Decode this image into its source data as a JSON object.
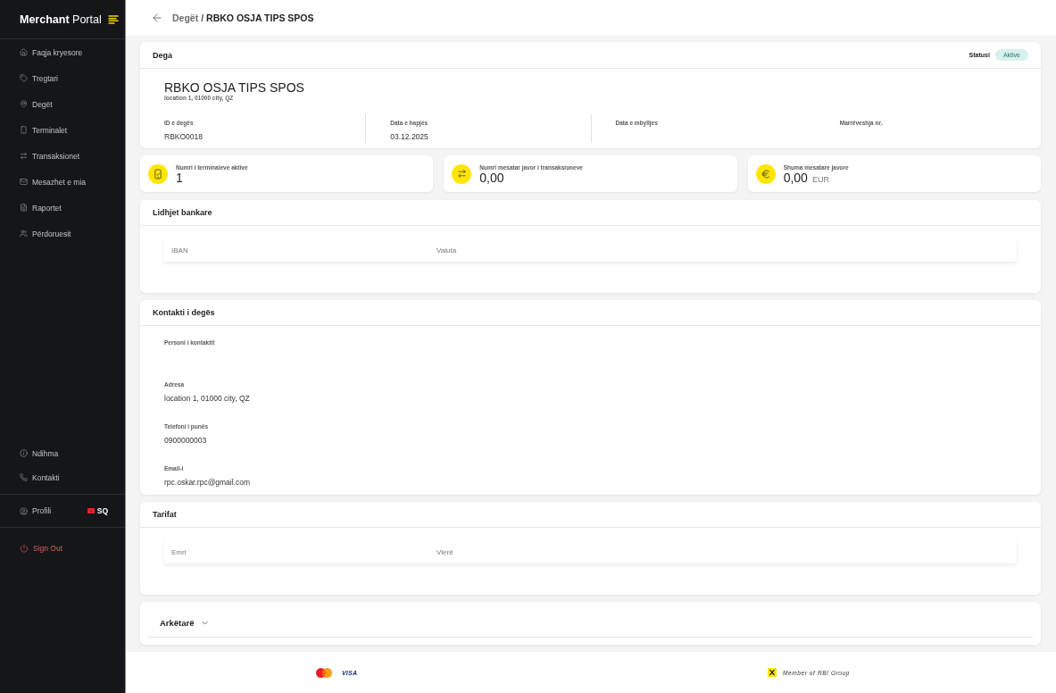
{
  "sidebar": {
    "brand": "**Merchant** Portal",
    "nav_items": [
      {
        "label": "Faqja kryesore",
        "selected": false
      },
      {
        "label": "Tregtari",
        "selected": false
      },
      {
        "label": "Degët",
        "selected": false
      },
      {
        "label": "Terminalet",
        "selected": false
      },
      {
        "label": "Transaksionet",
        "selected": false
      },
      {
        "label": "Mesazhet e mia",
        "selected": false
      },
      {
        "label": "Raportet",
        "selected": false
      },
      {
        "label": "Përdoruesit",
        "selected": false
      }
    ],
    "support_items": [
      {
        "label": "Ndihma"
      },
      {
        "label": "Kontakti"
      }
    ],
    "profile": {
      "label": "Profili",
      "language": "SQ"
    },
    "sign_out": "Sign Out"
  },
  "breadcrumb": {
    "parent": "Degët",
    "separator": "/",
    "current": "RBKO OSJA TIPS SPOS"
  },
  "branch": {
    "title": "Dega",
    "status_label": "Statusi",
    "status": "Aktive",
    "name": "RBKO OSJA TIPS SPOS",
    "address": "location 1, 01000 city, QZ",
    "fields": [
      {
        "label": "ID e degës",
        "value": "RBKO0018"
      },
      {
        "label": "Data e hapjes",
        "value": "03.12.2025"
      },
      {
        "label": "Data e mbylljes"
      },
      {
        "label": "Marrëveshja nr."
      }
    ]
  },
  "stats": [
    {
      "label": "Numri i terminaleve aktive",
      "value": "1"
    },
    {
      "label": "Numri mesatar javor i transaksioneve",
      "value": "0,00"
    },
    {
      "label": "Shuma mesatare javore",
      "value": "0,00",
      "unit": "EUR"
    }
  ],
  "bank_connections": {
    "title": "Lidhjet bankare",
    "columns": [
      "IBAN",
      "Valuta"
    ]
  },
  "contact": {
    "title": "Kontakti i degës",
    "fields": [
      {
        "label": "Personi i kontaktit"
      },
      {
        "label": "Adresa",
        "value": "location 1, 01000 city, QZ"
      },
      {
        "label": "Telefoni i punës",
        "value": "0900000003"
      },
      {
        "label": "Email-i",
        "value": "rpc.oskar.rpc@gmail.com"
      }
    ]
  },
  "tariffs": {
    "title": "Tarifat",
    "columns": [
      "Emri",
      "Vlerë"
    ]
  },
  "cashiers": {
    "title": "Arkëtarë",
    "expanded": false
  },
  "footer": {
    "card_brand": "VISA",
    "group_note": "Member of RBI Group"
  }
}
